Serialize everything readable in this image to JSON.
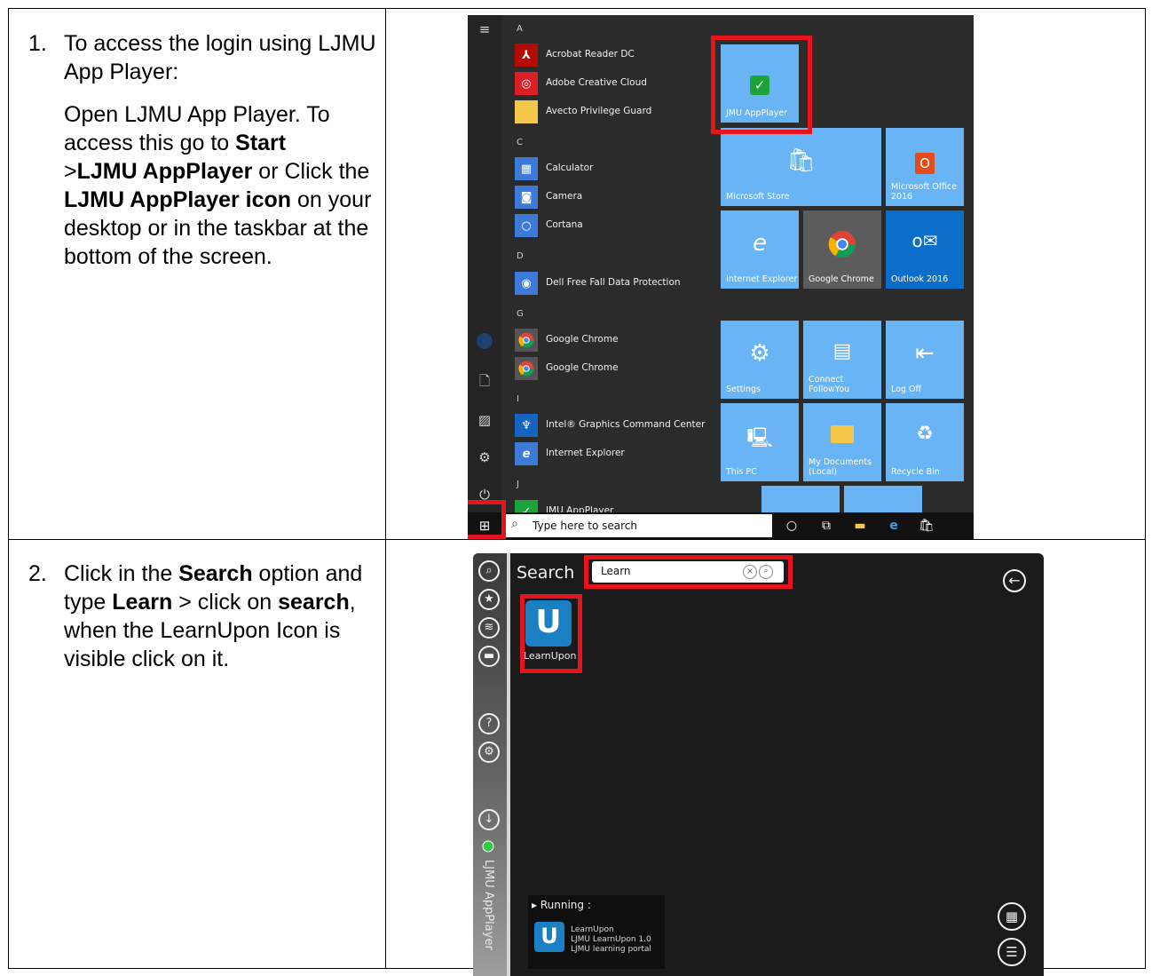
{
  "steps": [
    {
      "number": "1.",
      "intro": "To access the login using LJMU App Player:",
      "body": {
        "t1": "Open LJMU App Player. To access this go to ",
        "b1": "Start",
        "t2": " >",
        "b2": "LJMU AppPlayer",
        "t3": " or Click the ",
        "b3": "LJMU AppPlayer icon",
        "t4": " on your desktop or in the taskbar at the bottom of the screen."
      }
    },
    {
      "number": "2.",
      "body": {
        "t1": "Click in the ",
        "b1": "Search",
        "t2": " option and type ",
        "b2": "Learn",
        "t3": " > click on ",
        "b3": "search",
        "t4": ", when the LearnUpon Icon is visible click on it."
      }
    }
  ],
  "start_menu": {
    "letters": {
      "a": "A",
      "c": "C",
      "d": "D",
      "g": "G",
      "i": "I",
      "j": "J"
    },
    "apps": {
      "acrobat": "Acrobat Reader DC",
      "creative_cloud": "Adobe Creative Cloud",
      "avecto": "Avecto Privilege Guard",
      "calculator": "Calculator",
      "camera": "Camera",
      "cortana": "Cortana",
      "dell": "Dell Free Fall Data Protection",
      "chrome_1": "Google Chrome",
      "chrome_2": "Google Chrome",
      "intel": "Intel® Graphics Command Center",
      "ie": "Internet Explorer",
      "ljmu": "JMU AppPlayer"
    },
    "tiles": {
      "appplayer": "JMU AppPlayer",
      "store": "Microsoft Store",
      "office": "Microsoft Office 2016",
      "ie": "Internet Explorer",
      "chrome": "Google Chrome",
      "outlook": "Outlook 2016",
      "settings": "Settings",
      "connect": "Connect FollowYou",
      "logoff": "Log Off",
      "thispc": "This PC",
      "mydocs": "My Documents (Local)",
      "recycle": "Recycle Bin"
    },
    "taskbar_search_placeholder": "Type here to search"
  },
  "app_player": {
    "title": "Search",
    "search_value": "Learn",
    "result_label": "LearnUpon",
    "sidebar_label": "LJMU AppPlayer",
    "running": {
      "title": "Running :",
      "line1": "LearnUpon",
      "line2": "LJMU LearnUpon 1.0",
      "line3": "LJMU learning portal"
    }
  },
  "colors": {
    "highlight_red": "#e8131b",
    "tile_blue": "#69b4f5",
    "learnupon_blue": "#1b7fc4"
  }
}
